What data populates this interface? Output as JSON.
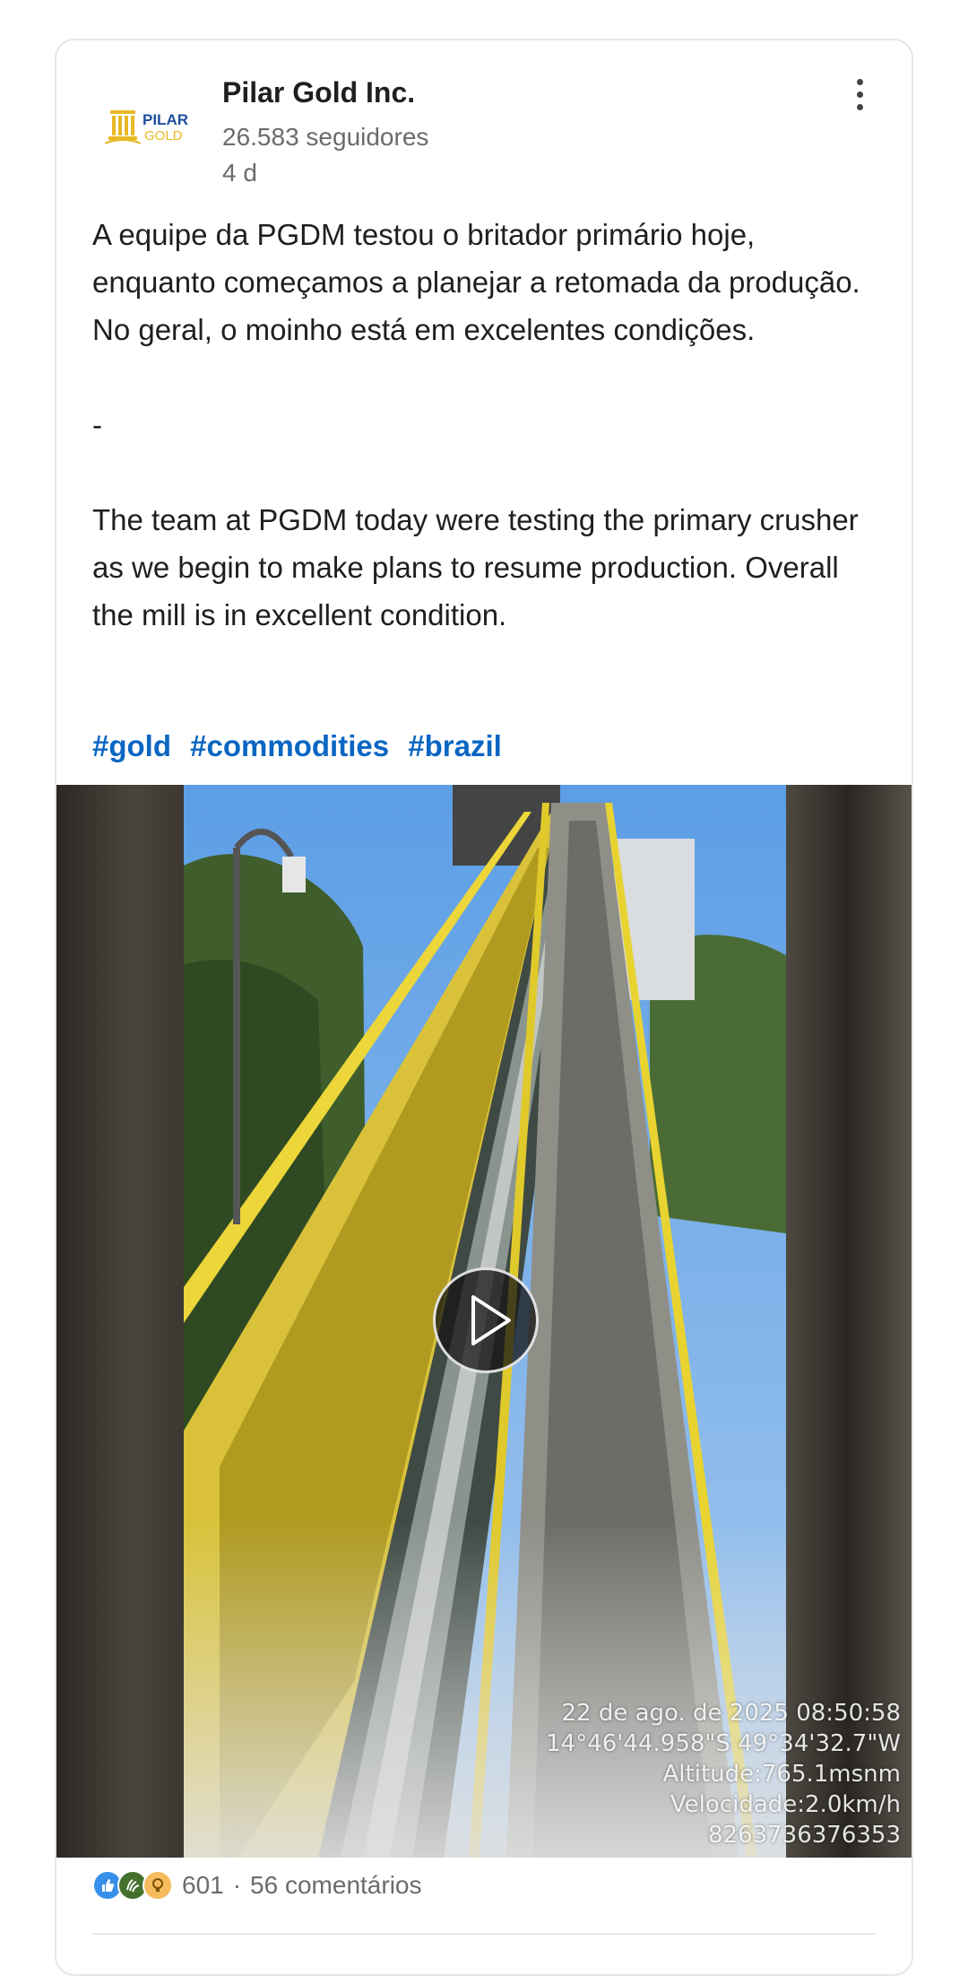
{
  "post": {
    "author": {
      "name": "Pilar Gold Inc.",
      "followers": "26.583 seguidores",
      "age": "4 d",
      "logo_text_line1": "PILAR",
      "logo_text_line2": "GOLD"
    },
    "text_pt": "A equipe da PGDM testou o britador primário hoje, enquanto começamos a planejar a retomada da produção. No geral, o moinho está em excelentes condições.",
    "separator": "-",
    "text_en": "The team at PGDM today were testing the primary crusher as we begin to make plans to resume production. Overall the mill is in excellent condition.",
    "hashtags": [
      "#gold",
      "#commodities",
      "#brazil"
    ],
    "video": {
      "overlay": [
        "22 de ago. de 2025 08:50:58",
        "14°46'44.958\"S 49°34'32.7\"W",
        "Altitude:765.1msnm",
        "Velocidade:2.0km/h",
        "8263736376353"
      ]
    },
    "footer": {
      "reaction_count": "601",
      "dot": "·",
      "comments": "56 comentários"
    }
  },
  "colors": {
    "link": "#0a66c2",
    "secondary_text": "#6b6b6b",
    "logo_gold": "#e8b923",
    "logo_blue": "#1e4fa0",
    "like_blue": "#378fe9",
    "celebrate_green": "#44712e",
    "insight_yellow": "#f5bb5c"
  },
  "icons": {
    "more": "more-vertical-icon",
    "play": "play-icon",
    "reactions": [
      "like-icon",
      "celebrate-icon",
      "insightful-icon"
    ]
  }
}
